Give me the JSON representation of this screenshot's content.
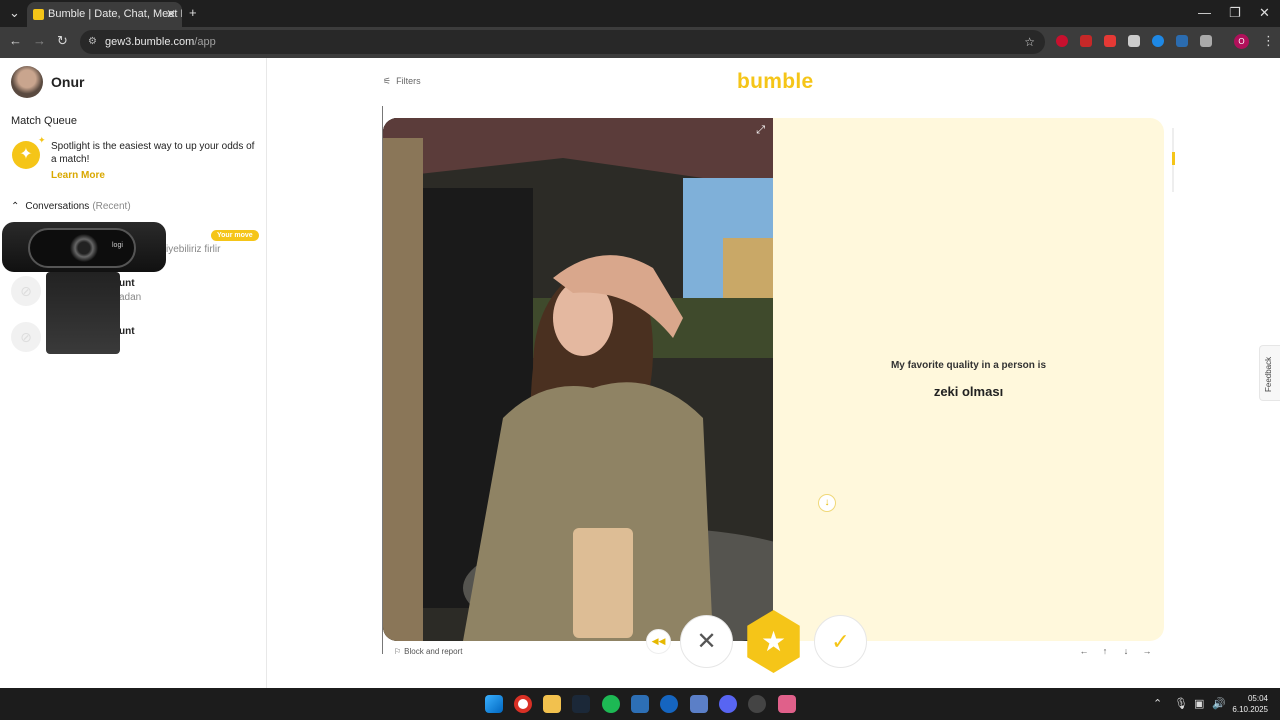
{
  "browser": {
    "tab_title": "Bumble | Date, Chat, Meet New",
    "url_host": "gew3.bumble.com",
    "url_path": "/app",
    "profile_letter": "O"
  },
  "sidebar": {
    "user_name": "Onur",
    "match_queue_label": "Match Queue",
    "spotlight_text": "Spotlight is the easiest way to up your odds of a match!",
    "learn_more": "Learn More",
    "conversations_label": "Conversations",
    "conversations_sub": "(Recent)",
    "your_move": "Your move",
    "conversations": [
      {
        "name": "",
        "message": "iyebiliriz firlir"
      },
      {
        "name": "unt",
        "message": "adan"
      },
      {
        "name": "unt",
        "message": ""
      }
    ],
    "webcam_logo": "logi"
  },
  "main": {
    "filters": "Filters",
    "logo": "bumble",
    "prompt_question": "My favorite quality in a person is",
    "prompt_answer": "zeki olması",
    "block_report": "Block and report",
    "feedback": "Feedback"
  },
  "taskbar": {
    "time": "05:04",
    "date": "6.10.2025"
  },
  "colors": {
    "brand": "#f5c518",
    "panel": "#fff8dc"
  }
}
